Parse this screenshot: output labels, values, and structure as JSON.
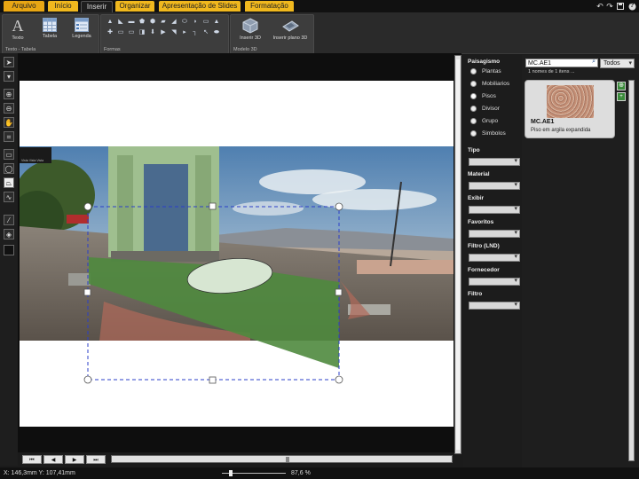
{
  "tabs": [
    {
      "label": "Arquivo"
    },
    {
      "label": "Início"
    },
    {
      "label": "Inserir"
    },
    {
      "label": "Organizar"
    },
    {
      "label": "Apresentação de Slides"
    },
    {
      "label": "Formatação"
    }
  ],
  "title_icons": [
    "undo-icon",
    "redo-icon",
    "save-icon",
    "help-icon"
  ],
  "help_glyph": "?",
  "ribbon": {
    "text_table_group": {
      "label": "Texto - Tabela",
      "buttons": [
        {
          "label": "Texto",
          "icon": "text-icon"
        },
        {
          "label": "Tabela",
          "icon": "table-icon"
        },
        {
          "label": "Legenda",
          "icon": "legend-icon"
        }
      ],
      "text_glyph": "A"
    },
    "shapes_group": {
      "label": "Formas"
    },
    "model3d_group": {
      "label": "Modelo 3D",
      "buttons": [
        {
          "label": "Inserir 3D",
          "icon": "cube-3d-icon"
        },
        {
          "label": "Inserir plano 3D",
          "icon": "plane-3d-icon"
        }
      ]
    }
  },
  "left_tools": [
    "select-arrow-icon",
    "layer-down-icon",
    "zoom-in-icon",
    "zoom-out-icon",
    "pan-icon",
    "crop-icon",
    "rectangle-icon",
    "ellipse-icon",
    "polygon-icon",
    "curve-icon",
    "eyedropper-icon",
    "fill-icon",
    "color-swatch-icon"
  ],
  "canvas": {
    "tooltip_label": "Vista Vista Vista"
  },
  "nav": {
    "first": "⏮",
    "prev": "◀",
    "next": "▶",
    "last": "⏭"
  },
  "status": {
    "coords": "X: 146,3mm Y: 107,41mm",
    "zoom": "87,6 %"
  },
  "filters": {
    "category_title": "Paisagismo",
    "options": [
      "Plantas",
      "Mobiliarios",
      "Pisos",
      "Divisor",
      "Grupo",
      "Simbolos"
    ],
    "selected": "Pisos",
    "sections": [
      "Tipo",
      "Material",
      "Exibir",
      "Favoritos",
      "Filtro (LND)",
      "Fornecedor",
      "Filtro"
    ]
  },
  "search": {
    "value": "MC.AE1",
    "scope": "Todos",
    "result_count": "1 nomes de 1 itens ..."
  },
  "result_item": {
    "name": "MC.AE1",
    "description": "Piso em argila expandida"
  }
}
